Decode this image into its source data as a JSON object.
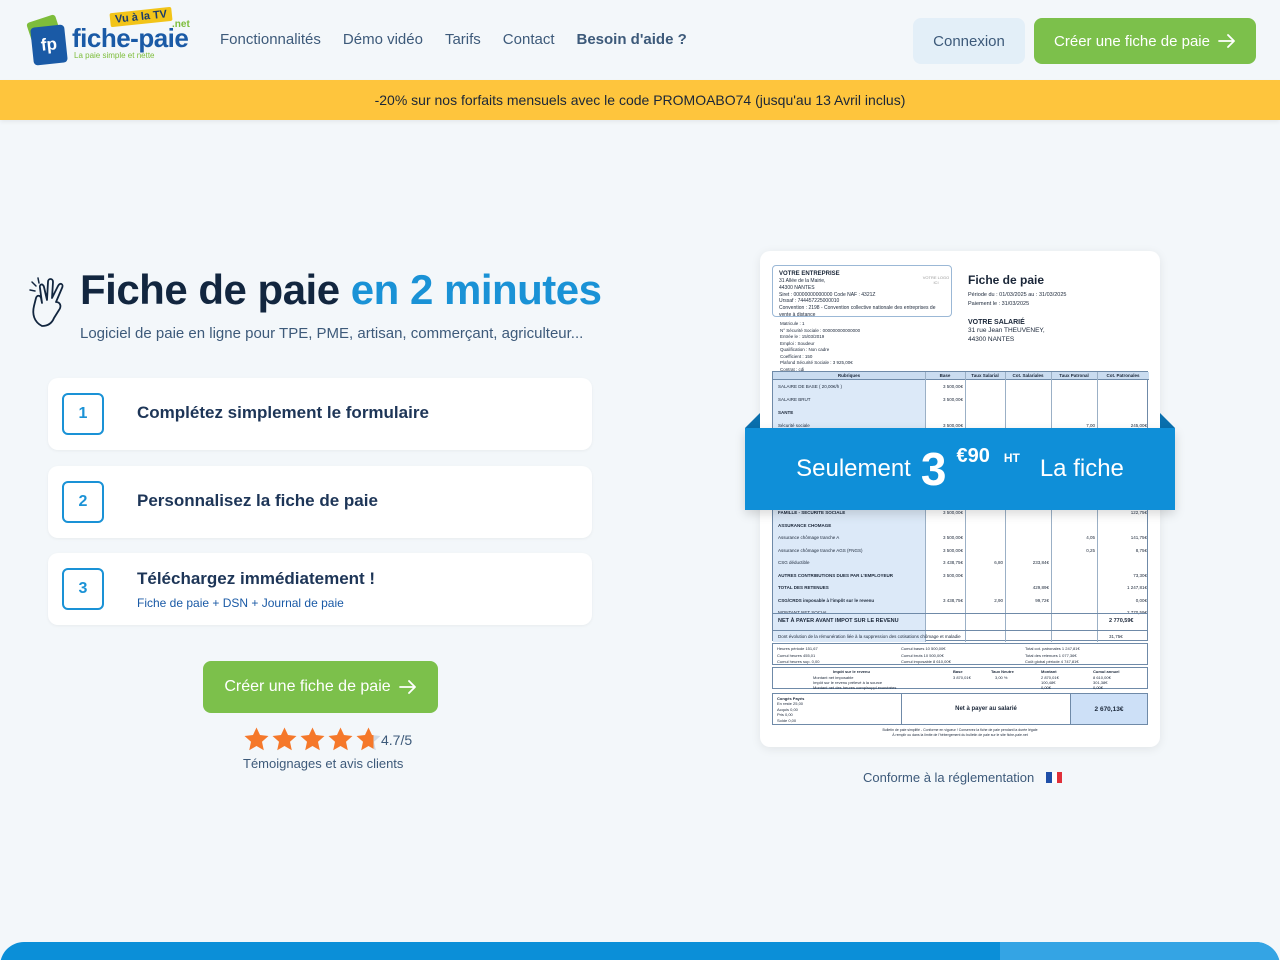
{
  "header": {
    "logo": {
      "brand": "fiche-paie",
      "tld": ".net",
      "tv_badge": "Vu à la TV",
      "badge_letters": "fp",
      "tagline": "La paie simple et nette"
    },
    "nav": [
      {
        "label": "Fonctionnalités"
      },
      {
        "label": "Démo vidéo"
      },
      {
        "label": "Tarifs"
      },
      {
        "label": "Contact"
      },
      {
        "label": "Besoin d'aide ?"
      }
    ],
    "login_label": "Connexion",
    "create_label": "Créer une fiche de paie"
  },
  "promo": {
    "text": "-20% sur nos forfaits mensuels avec le code PROMOABO74 (jusqu'au 13 Avril inclus)"
  },
  "hero": {
    "title_main": "Fiche de paie",
    "title_accent": "en 2 minutes",
    "subtitle": "Logiciel de paie en ligne pour TPE, PME, artisan, commerçant, agriculteur...",
    "steps": [
      {
        "num": "1",
        "text": "Complétez simplement le formulaire"
      },
      {
        "num": "2",
        "text": "Personnalisez la fiche de paie"
      },
      {
        "num": "3",
        "text": "Téléchargez immédiatement !",
        "sub": "Fiche de paie + DSN + Journal de paie"
      }
    ],
    "cta_label": "Créer une fiche de paie",
    "rating_value": 4.7,
    "rating_text": "4.7/5",
    "reviews_label": "Témoignages et avis clients"
  },
  "payslip": {
    "company_title": "VOTRE ENTREPRISE",
    "company_addr1": "31 Allée de la Mairie,",
    "company_addr2": "44300 NANTES",
    "company_siret": "Siret : 00000000000000 Code NAF : 4321Z",
    "company_urssaf": "Urssaf : 744457225000010",
    "company_conv": "Convention : 2198 - Convention collective nationale des entreprises de vente à distance",
    "logo_placeholder": "VOTRE LOGO ICI",
    "title": "Fiche de paie",
    "period_line": "Période du : 01/03/2025 au : 31/03/2025",
    "payment_line": "Paiement le : 31/03/2025",
    "emp_lines": [
      "Matricule : 1",
      "N° Sécurité Sociale : 000000000000000",
      "Entrée le : 15/03/2019",
      "Emploi : Soudeur",
      "Qualification : Non cadre",
      "Coefficient : 150",
      "Plafond Sécurité Sociale : 3 925,00€",
      "Contrat : cdi"
    ],
    "salarie_title": "VOTRE SALARIÉ",
    "salarie_addr1": "31 rue Jean THEUVENEY,",
    "salarie_addr2": "44300 NANTES",
    "table_headers": [
      "Rubriques",
      "Base",
      "Taux Salarial",
      "Cot. Salariales",
      "Taux Patronal",
      "Cot. Patronales"
    ],
    "rows_top": [
      {
        "label": "SALAIRE DE BASE ( 20,00€/h )",
        "base": "3 500,00€",
        "bold": false
      },
      {
        "label": "SALAIRE BRUT",
        "base": "3 500,00€",
        "bold": false
      },
      {
        "label": "SANTE",
        "base": "",
        "bold": true
      },
      {
        "label": "Sécurité sociale",
        "base": "3 500,00€",
        "rate_p": "7,00",
        "cot_p": "245,00€",
        "bold": false
      }
    ],
    "rows_bottom": [
      {
        "label": "FAMILLE - SECURITE SOCIALE",
        "base": "3 500,00€",
        "cot_p": "122,75€",
        "bold": true
      },
      {
        "label": "ASSURANCE CHOMAGE",
        "base": "",
        "bold": true
      },
      {
        "label": "Assurance chômage tranche A",
        "base": "3 500,00€",
        "rate_p": "4,05",
        "cot_p": "141,75€",
        "bold": false
      },
      {
        "label": "Assurance chômage tranche AGS (FNGS)",
        "base": "3 500,00€",
        "rate_p": "0,25",
        "cot_p": "8,75€",
        "bold": false
      },
      {
        "label": "CSG déductible",
        "base": "3 438,75€",
        "rate_s": "6,80",
        "cot_s": "233,84€",
        "bold": false
      },
      {
        "label": "AUTRES CONTRIBUTIONS DUES PAR L'EMPLOYEUR",
        "base": "3 500,00€",
        "cot_p": "73,30€",
        "bold": true
      },
      {
        "label": "TOTAL DES RETENUES",
        "cot_s": "429,89€",
        "cot_p": "1 247,81€",
        "bold": true
      },
      {
        "label": "CSG/CRDS imposable à l'impôt sur le revenu",
        "base": "3 438,75€",
        "rate_s": "2,90",
        "cot_s": "99,72€",
        "cot_p": "0,00€",
        "bold": true
      },
      {
        "label": "MONTANT NET SOCIAL",
        "cot_p": "2 770,59€",
        "bold": false
      }
    ],
    "net_before_tax_label": "NET À PAYER AVANT IMPOT SUR LE REVENU",
    "net_before_tax_value": "2 770,59€",
    "evolution_note": "Dont évolution de la rémunération liée à la suppression des cotisations chômage et maladie",
    "evolution_value": "31,75€",
    "sums": [
      "Heures période  151,67",
      "Cumul heures  455,01",
      "Cumul heures sup.  0,00",
      "Cumul bases  10 500,00€",
      "Cumul bruts  10 500,00€",
      "Cumul imposable  8 610,00€",
      "Total cot. patronales  1 247,81€",
      "Total des retenues  1 077,36€",
      "Coût global période  4 747,81€"
    ],
    "tax_headers": [
      "Impôt sur le revenu",
      "Base",
      "Taux Neutre",
      "Montant",
      "Cumul annuel"
    ],
    "tax_rows": [
      "Montant net imposable",
      "Impôt sur le revenu prélevé à la source",
      "Montant net des heures comp/suppl exonérées"
    ],
    "tax_values": [
      "3 870,01€",
      "3,00 %",
      "2 870,01€",
      "100,48€",
      "0,00€",
      "8 610,00€",
      "301,38€",
      "0,00€"
    ],
    "conges": [
      "Congés Payés",
      "En reste  25,00",
      "Acquis  0,00",
      "Pris  0,00",
      "Solde  0,00"
    ],
    "net_pay_label": "Net à payer au salarié",
    "net_pay_value": "2 670,13€",
    "footnote1": "Bulletin de paie simplifié - Conforme en vigueur ! Conservez la fiche de paie pendant la durée légale",
    "footnote2": "À remplir ou dans la limite de l'hébergement du bulletin de paie sur le site fiche-paie.net"
  },
  "ribbon": {
    "prefix": "Seulement",
    "price_int": "3",
    "price_dec": "€90",
    "ht": "HT",
    "suffix": "La fiche"
  },
  "conforme_text": "Conforme à la réglementation",
  "colors": {
    "accent_blue": "#1a92d6",
    "green": "#7cc04b",
    "promo_yellow": "#fec53d",
    "star_orange": "#f5782a"
  }
}
